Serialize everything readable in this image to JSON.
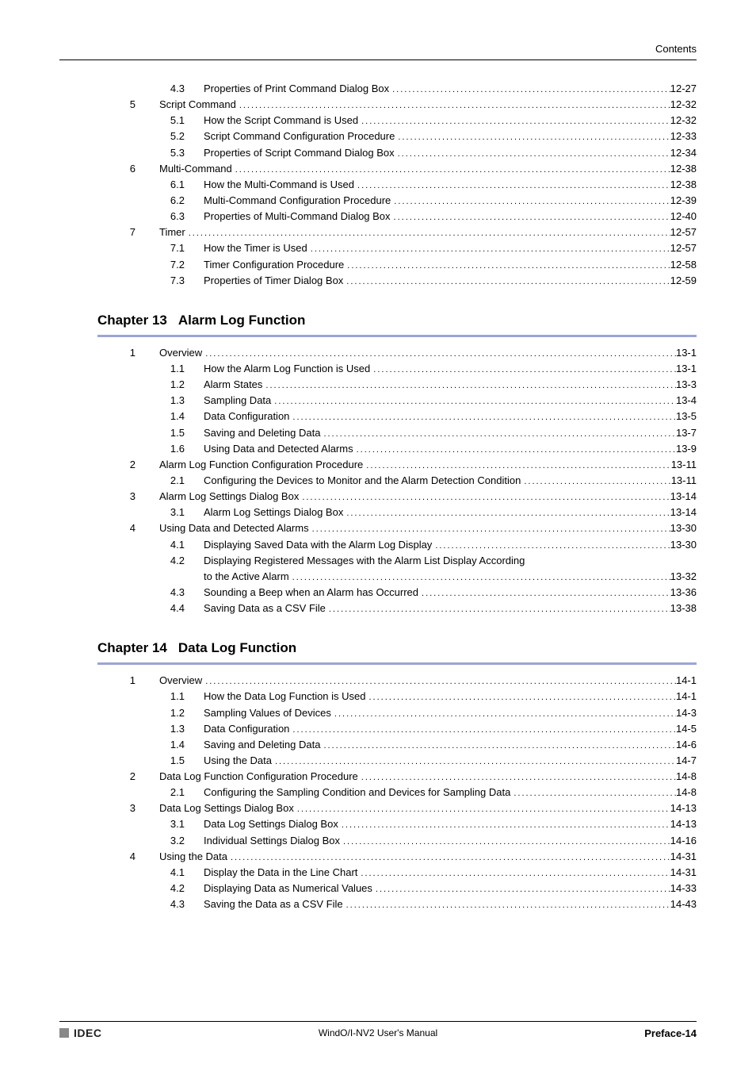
{
  "header": {
    "label": "Contents"
  },
  "pretoc": [
    {
      "level": "sub",
      "num": "4.3",
      "label": "Properties of Print Command Dialog Box",
      "page": "12-27"
    },
    {
      "level": "sec",
      "num": "5",
      "label": "Script Command",
      "page": "12-32"
    },
    {
      "level": "sub",
      "num": "5.1",
      "label": "How the Script Command is Used",
      "page": "12-32"
    },
    {
      "level": "sub",
      "num": "5.2",
      "label": "Script Command Configuration Procedure",
      "page": "12-33"
    },
    {
      "level": "sub",
      "num": "5.3",
      "label": "Properties of Script Command Dialog Box",
      "page": "12-34"
    },
    {
      "level": "sec",
      "num": "6",
      "label": "Multi-Command",
      "page": "12-38"
    },
    {
      "level": "sub",
      "num": "6.1",
      "label": "How the Multi-Command is Used",
      "page": "12-38"
    },
    {
      "level": "sub",
      "num": "6.2",
      "label": "Multi-Command Configuration Procedure",
      "page": "12-39"
    },
    {
      "level": "sub",
      "num": "6.3",
      "label": "Properties of Multi-Command Dialog Box",
      "page": "12-40"
    },
    {
      "level": "sec",
      "num": "7",
      "label": "Timer",
      "page": "12-57"
    },
    {
      "level": "sub",
      "num": "7.1",
      "label": "How the Timer is Used",
      "page": "12-57"
    },
    {
      "level": "sub",
      "num": "7.2",
      "label": "Timer Configuration Procedure",
      "page": "12-58"
    },
    {
      "level": "sub",
      "num": "7.3",
      "label": "Properties of Timer Dialog Box",
      "page": "12-59"
    }
  ],
  "chapters": [
    {
      "chapter_label": "Chapter 13",
      "chapter_title": "Alarm Log Function",
      "rows": [
        {
          "level": "sec",
          "num": "1",
          "label": "Overview",
          "page": "13-1"
        },
        {
          "level": "sub",
          "num": "1.1",
          "label": "How the Alarm Log Function is Used",
          "page": "13-1"
        },
        {
          "level": "sub",
          "num": "1.2",
          "label": "Alarm States",
          "page": "13-3"
        },
        {
          "level": "sub",
          "num": "1.3",
          "label": "Sampling Data",
          "page": "13-4"
        },
        {
          "level": "sub",
          "num": "1.4",
          "label": "Data Configuration",
          "page": "13-5"
        },
        {
          "level": "sub",
          "num": "1.5",
          "label": "Saving and Deleting Data",
          "page": "13-7"
        },
        {
          "level": "sub",
          "num": "1.6",
          "label": "Using Data and Detected Alarms",
          "page": "13-9"
        },
        {
          "level": "sec",
          "num": "2",
          "label": "Alarm Log Function Configuration Procedure",
          "page": "13-11"
        },
        {
          "level": "sub",
          "num": "2.1",
          "label": "Configuring the Devices to Monitor and the Alarm Detection Condition",
          "page": "13-11"
        },
        {
          "level": "sec",
          "num": "3",
          "label": "Alarm Log Settings Dialog Box",
          "page": "13-14"
        },
        {
          "level": "sub",
          "num": "3.1",
          "label": "Alarm Log Settings Dialog Box",
          "page": "13-14"
        },
        {
          "level": "sec",
          "num": "4",
          "label": "Using Data and Detected Alarms",
          "page": "13-30"
        },
        {
          "level": "sub",
          "num": "4.1",
          "label": "Displaying Saved Data with the Alarm Log Display",
          "page": "13-30"
        },
        {
          "level": "sub",
          "num": "4.2",
          "label": "Displaying Registered Messages with the Alarm List Display According",
          "label2": "to the Active Alarm",
          "page": "13-32",
          "wrap": true
        },
        {
          "level": "sub",
          "num": "4.3",
          "label": "Sounding a Beep when an Alarm has Occurred",
          "page": "13-36"
        },
        {
          "level": "sub",
          "num": "4.4",
          "label": "Saving Data as a CSV File",
          "page": "13-38"
        }
      ]
    },
    {
      "chapter_label": "Chapter 14",
      "chapter_title": "Data Log Function",
      "rows": [
        {
          "level": "sec",
          "num": "1",
          "label": "Overview",
          "page": "14-1"
        },
        {
          "level": "sub",
          "num": "1.1",
          "label": "How the Data Log Function is Used",
          "page": "14-1"
        },
        {
          "level": "sub",
          "num": "1.2",
          "label": "Sampling Values of Devices",
          "page": "14-3"
        },
        {
          "level": "sub",
          "num": "1.3",
          "label": "Data Configuration",
          "page": "14-5"
        },
        {
          "level": "sub",
          "num": "1.4",
          "label": "Saving and Deleting Data",
          "page": "14-6"
        },
        {
          "level": "sub",
          "num": "1.5",
          "label": "Using the Data",
          "page": "14-7"
        },
        {
          "level": "sec",
          "num": "2",
          "label": "Data Log Function Configuration Procedure",
          "page": "14-8"
        },
        {
          "level": "sub",
          "num": "2.1",
          "label": "Configuring the Sampling Condition and Devices for Sampling Data",
          "page": "14-8"
        },
        {
          "level": "sec",
          "num": "3",
          "label": "Data Log Settings Dialog Box",
          "page": "14-13"
        },
        {
          "level": "sub",
          "num": "3.1",
          "label": "Data Log Settings Dialog Box",
          "page": "14-13"
        },
        {
          "level": "sub",
          "num": "3.2",
          "label": "Individual Settings Dialog Box",
          "page": "14-16"
        },
        {
          "level": "sec",
          "num": "4",
          "label": "Using the Data",
          "page": "14-31"
        },
        {
          "level": "sub",
          "num": "4.1",
          "label": "Display the Data in the Line Chart",
          "page": "14-31"
        },
        {
          "level": "sub",
          "num": "4.2",
          "label": "Displaying Data as Numerical Values",
          "page": "14-33"
        },
        {
          "level": "sub",
          "num": "4.3",
          "label": "Saving the Data as a CSV File",
          "page": "14-43"
        }
      ]
    }
  ],
  "footer": {
    "brand": "IDEC",
    "center": "WindO/I-NV2 User's Manual",
    "right": "Preface-14"
  }
}
